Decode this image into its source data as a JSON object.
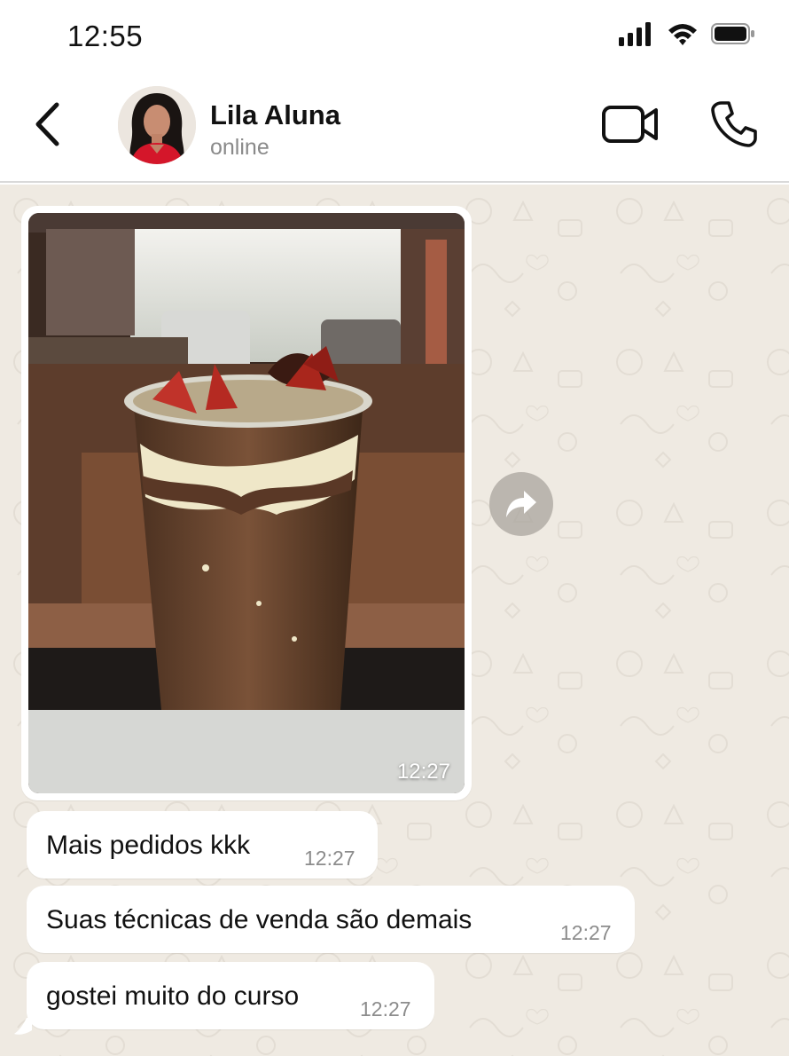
{
  "status_bar": {
    "time": "12:55",
    "icons": [
      "signal-icon",
      "wifi-icon",
      "battery-icon"
    ]
  },
  "header": {
    "contact_name": "Lila Aluna",
    "contact_status": "online",
    "actions": [
      "back-arrow-icon",
      "video-camera-icon",
      "phone-icon"
    ]
  },
  "messages": [
    {
      "type": "image",
      "alt": "Copo de sobremesa com chocolate, creme e morangos",
      "time": "12:27"
    },
    {
      "type": "text",
      "text": "Mais pedidos kkk",
      "time": "12:27"
    },
    {
      "type": "text",
      "text": "Suas técnicas de venda são demais",
      "time": "12:27"
    },
    {
      "type": "text",
      "text": "gostei muito do curso",
      "time": "12:27"
    }
  ],
  "colors": {
    "chat_background": "#efeae2",
    "bubble_incoming": "#ffffff",
    "text_primary": "#111111",
    "text_secondary": "#8a8a8a"
  }
}
